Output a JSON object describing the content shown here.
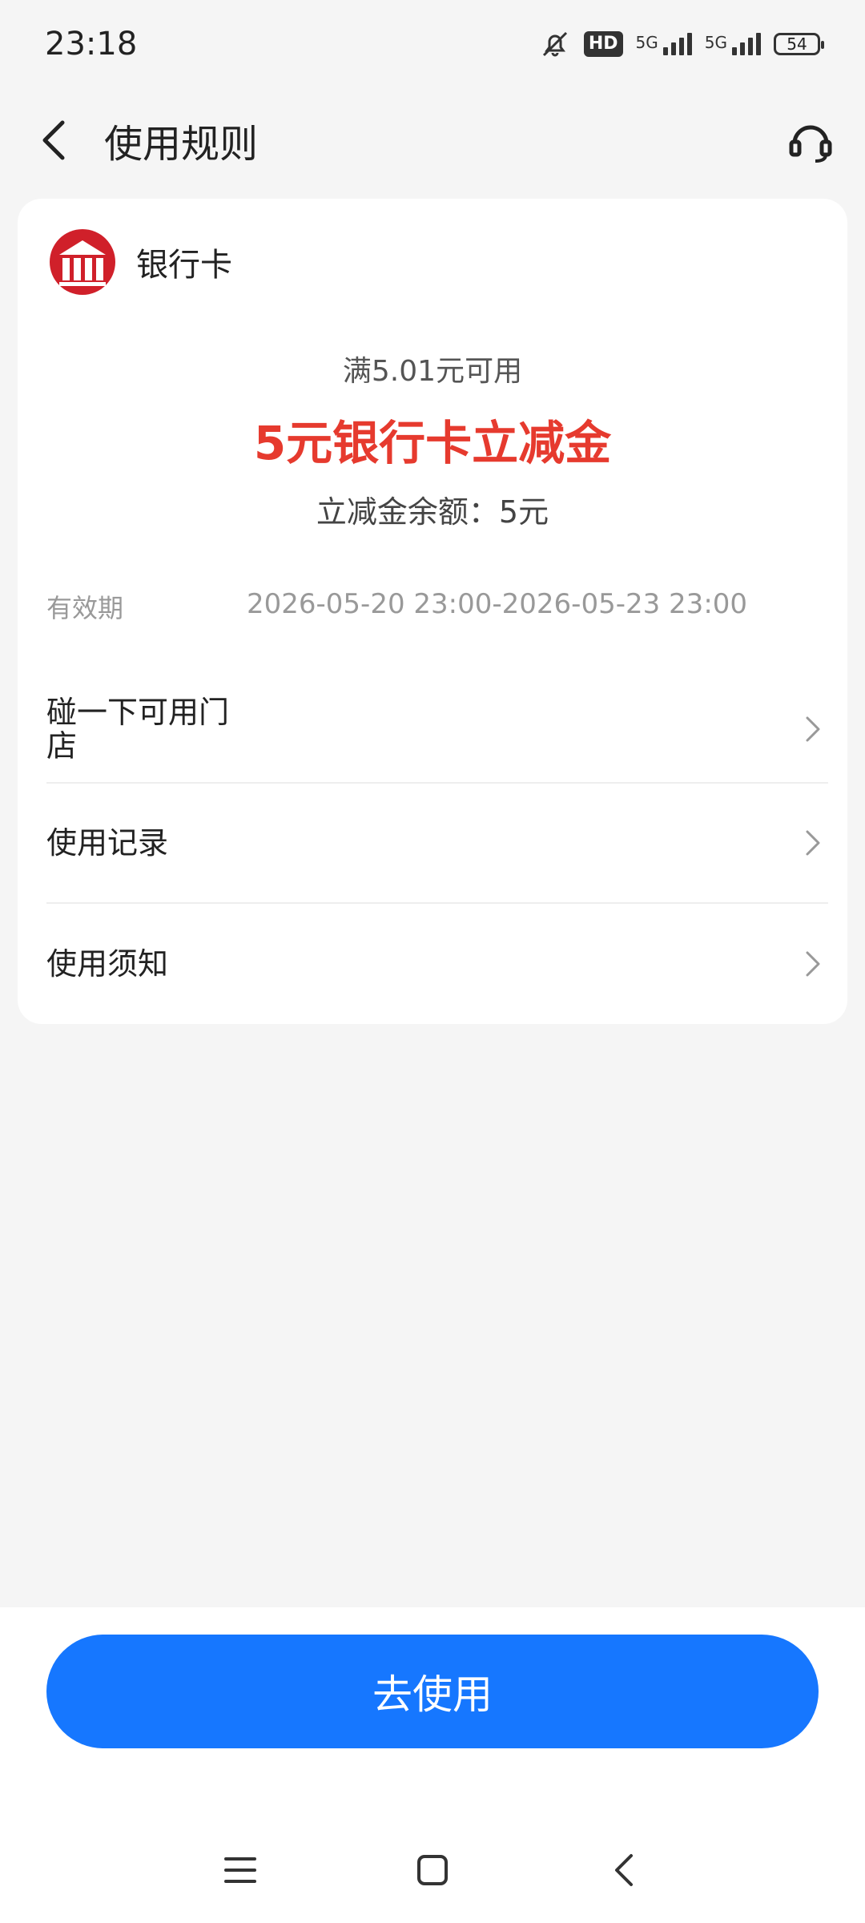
{
  "status_bar": {
    "time": "23:18",
    "hd_label": "HD",
    "signal_label_1": "5G",
    "signal_label_2": "5G",
    "battery": "54"
  },
  "nav": {
    "title": "使用规则",
    "back_icon": "back-arrow-icon",
    "service_icon": "headset-icon"
  },
  "card": {
    "bank_name": "银行卡",
    "threshold": "满5.01元可用",
    "title": "5元银行卡立减金",
    "balance": "立减金余额：5元",
    "validity_label": "有效期",
    "validity_value": "2026-05-20 23:00-2026-05-23 23:00",
    "rows": [
      {
        "label": "碰一下可用门店"
      },
      {
        "label": "使用记录"
      },
      {
        "label": "使用须知"
      }
    ]
  },
  "bottom": {
    "button_label": "去使用"
  },
  "colors": {
    "accent_blue": "#1677ff",
    "highlight_red": "#e63a2e",
    "logo_red": "#d0202a"
  }
}
